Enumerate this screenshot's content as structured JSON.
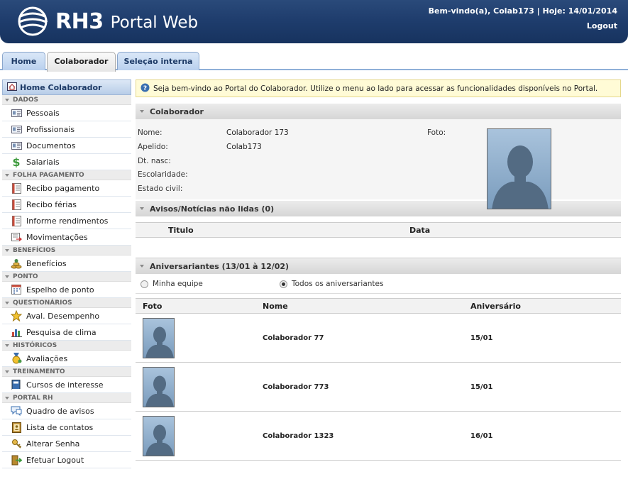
{
  "header": {
    "brand": "RH3",
    "subtitle": "Portal Web",
    "welcome": "Bem-vindo(a), Colab173 | Hoje: 14/01/2014",
    "logout": "Logout"
  },
  "tabs": [
    {
      "label": "Home"
    },
    {
      "label": "Colaborador"
    },
    {
      "label": "Seleção interna"
    }
  ],
  "sidebar": {
    "title": "Home Colaborador",
    "sections": [
      {
        "label": "DADOS",
        "items": [
          {
            "label": "Pessoais",
            "icon": "id-card-icon"
          },
          {
            "label": "Profissionais",
            "icon": "id-card-icon"
          },
          {
            "label": "Documentos",
            "icon": "id-card-icon"
          },
          {
            "label": "Salariais",
            "icon": "dollar-icon"
          }
        ]
      },
      {
        "label": "FOLHA PAGAMENTO",
        "items": [
          {
            "label": "Recibo pagamento",
            "icon": "receipt-icon"
          },
          {
            "label": "Recibo férias",
            "icon": "receipt-icon"
          },
          {
            "label": "Informe rendimentos",
            "icon": "receipt-icon"
          },
          {
            "label": "Movimentações",
            "icon": "transfer-icon"
          }
        ]
      },
      {
        "label": "BENEFÍCIOS",
        "items": [
          {
            "label": "Benefícios",
            "icon": "coins-icon"
          }
        ]
      },
      {
        "label": "PONTO",
        "items": [
          {
            "label": "Espelho de ponto",
            "icon": "calendar-icon"
          }
        ]
      },
      {
        "label": "QUESTIONÁRIOS",
        "items": [
          {
            "label": "Aval. Desempenho",
            "icon": "star-icon"
          },
          {
            "label": "Pesquisa de clima",
            "icon": "bar-chart-icon"
          }
        ]
      },
      {
        "label": "HISTÓRICOS",
        "items": [
          {
            "label": "Avaliações",
            "icon": "medal-icon"
          }
        ]
      },
      {
        "label": "TREINAMENTO",
        "items": [
          {
            "label": "Cursos de interesse",
            "icon": "book-icon"
          }
        ]
      },
      {
        "label": "PORTAL RH",
        "items": [
          {
            "label": "Quadro de avisos",
            "icon": "speech-bubble-icon"
          },
          {
            "label": "Lista de contatos",
            "icon": "contacts-icon"
          },
          {
            "label": "Alterar Senha",
            "icon": "key-icon"
          },
          {
            "label": "Efetuar Logout",
            "icon": "exit-icon"
          }
        ]
      }
    ]
  },
  "info_message": "Seja bem-vindo ao Portal do Colaborador. Utilize o menu ao lado para acessar as funcionalidades disponíveis no Portal.",
  "colaborador": {
    "title": "Colaborador",
    "fields": [
      {
        "label": "Nome:",
        "value": "Colaborador 173"
      },
      {
        "label": "Apelido:",
        "value": "Colab173"
      },
      {
        "label": "Dt. nasc:",
        "value": ""
      },
      {
        "label": "Escolaridade:",
        "value": ""
      },
      {
        "label": "Estado civil:",
        "value": ""
      }
    ],
    "photo_label": "Foto:"
  },
  "avisos": {
    "title": "Avisos/Notícias não lidas (0)",
    "col_titulo": "Titulo",
    "col_data": "Data"
  },
  "aniversariantes": {
    "title": "Aniversariantes (13/01 à 12/02)",
    "radio_equipe": "Minha equipe",
    "radio_todos": "Todos os aniversariantes",
    "selected": "todos",
    "col_foto": "Foto",
    "col_nome": "Nome",
    "col_aniversario": "Aniversário",
    "rows": [
      {
        "nome": "Colaborador 77",
        "data": "15/01"
      },
      {
        "nome": "Colaborador 773",
        "data": "15/01"
      },
      {
        "nome": "Colaborador 1323",
        "data": "16/01"
      }
    ]
  }
}
